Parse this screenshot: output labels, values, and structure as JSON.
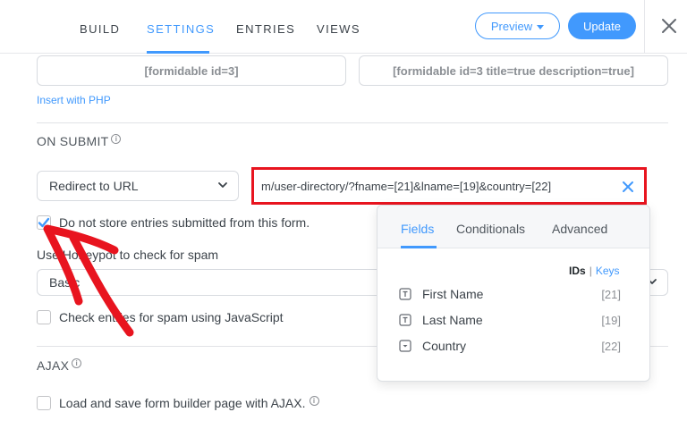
{
  "nav": {
    "tabs": [
      "BUILD",
      "SETTINGS",
      "ENTRIES",
      "VIEWS"
    ],
    "active_tab": "SETTINGS",
    "preview_label": "Preview",
    "update_label": "Update"
  },
  "shortcodes": {
    "basic": "[formidable id=3]",
    "full": "[formidable id=3 title=true description=true]",
    "php_link": "Insert with PHP"
  },
  "on_submit": {
    "title": "ON SUBMIT",
    "action_selected": "Redirect to URL",
    "redirect_url": "m/user-directory/?fname=[21]&lname=[19]&country=[22]"
  },
  "options": {
    "no_store_label": "Do not store entries submitted from this form.",
    "no_store_checked": true,
    "honeypot_label": "Use Honeypot to check for spam",
    "honeypot_select": "Basic",
    "js_spam_label": "Check entries for spam using JavaScript",
    "js_spam_checked": false
  },
  "ajax": {
    "title": "AJAX",
    "ajax_label": "Load and save form builder page with AJAX.",
    "ajax_checked": false
  },
  "popover": {
    "tabs": [
      "Fields",
      "Conditionals",
      "Advanced"
    ],
    "active_tab": "Fields",
    "toggle_ids": "IDs",
    "toggle_sep": "|",
    "toggle_keys": "Keys",
    "fields": [
      {
        "name": "First Name",
        "id": "[21]",
        "icon": "text-field-icon"
      },
      {
        "name": "Last Name",
        "id": "[19]",
        "icon": "text-field-icon"
      },
      {
        "name": "Country",
        "id": "[22]",
        "icon": "dropdown-field-icon"
      }
    ]
  },
  "colors": {
    "accent": "#4199fd",
    "highlight_border": "#e8141f",
    "annotation_arrow": "#e8141f"
  }
}
